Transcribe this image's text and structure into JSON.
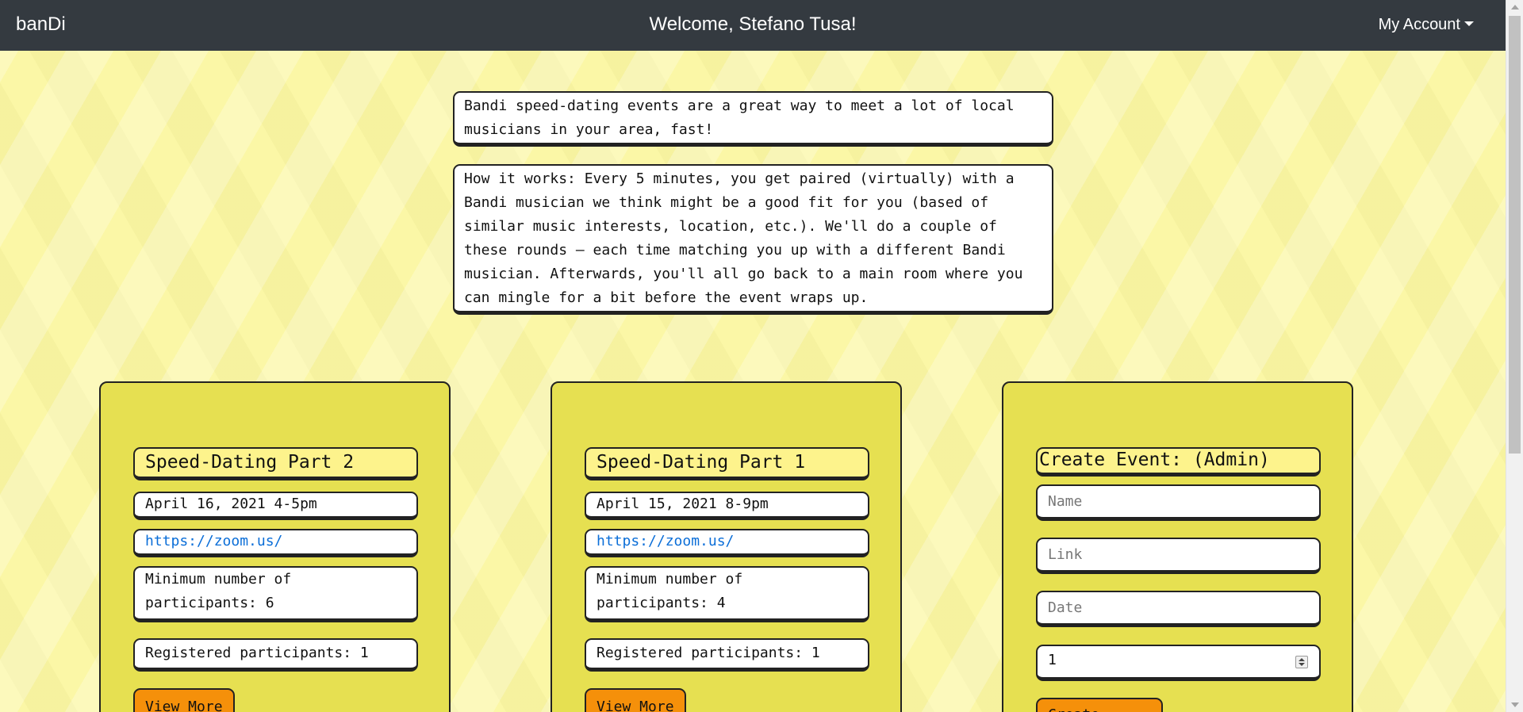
{
  "navbar": {
    "brand": "banDi",
    "welcome": "Welcome, Stefano Tusa!",
    "account_label": "My Account"
  },
  "info": {
    "intro": "Bandi speed-dating events are a great way to meet a lot of local musicians in your area, fast!",
    "how_it_works": "How it works: Every 5 minutes, you get paired (virtually) with a Bandi musician we think might be a good fit for you (based of similar music interests, location, etc.). We'll do a couple of these rounds — each time matching you up with a different Bandi musician. Afterwards, you'll all go back to a main room where you can mingle for a bit before the event wraps up."
  },
  "events": [
    {
      "title": "Speed-Dating Part 2",
      "date": "April 16, 2021 4-5pm",
      "link": "https://zoom.us/",
      "min_participants": "Minimum number of participants: 6",
      "registered": "Registered participants: 1",
      "button_label": "View More"
    },
    {
      "title": "Speed-Dating Part 1",
      "date": "April 15, 2021 8-9pm",
      "link": "https://zoom.us/",
      "min_participants": "Minimum number of participants: 4",
      "registered": "Registered participants: 1",
      "button_label": "View More"
    }
  ],
  "admin": {
    "title": "Create Event: (Admin)",
    "name_placeholder": "Name",
    "link_placeholder": "Link",
    "date_placeholder": "Date",
    "number_value": "1",
    "button_label": "Create Event"
  },
  "colors": {
    "navbar": "#343a40",
    "page_background": "#fbf7a6",
    "card_background": "#e6e051",
    "title_background": "#fdf38c",
    "button": "#f5900a",
    "link": "#0b6ed8"
  }
}
